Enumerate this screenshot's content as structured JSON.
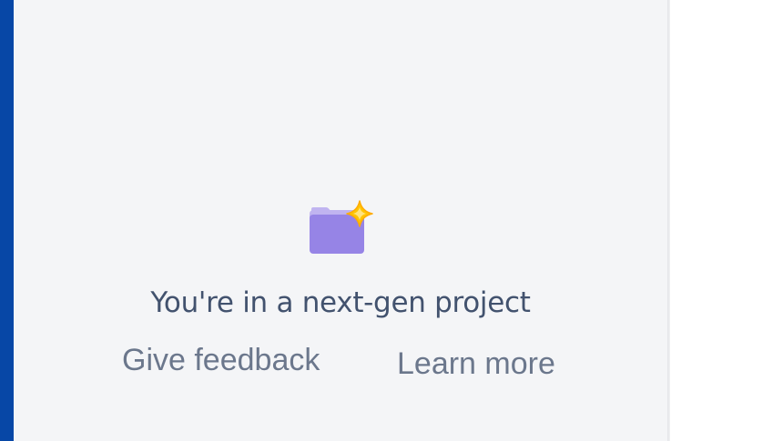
{
  "project_sidebar": {
    "nextgen_icon": "folder-sparkle-icon",
    "message": "You're in a next-gen project",
    "give_feedback_label": "Give feedback",
    "learn_more_label": "Learn more"
  },
  "colors": {
    "global_nav": "#0747a6",
    "sidebar_bg": "#f4f5f7",
    "heading_text": "#42526e",
    "link_text": "#6b778c",
    "folder_body": "#9684e6",
    "folder_tab": "#c0b4f0",
    "sparkle": "#ffc400"
  }
}
